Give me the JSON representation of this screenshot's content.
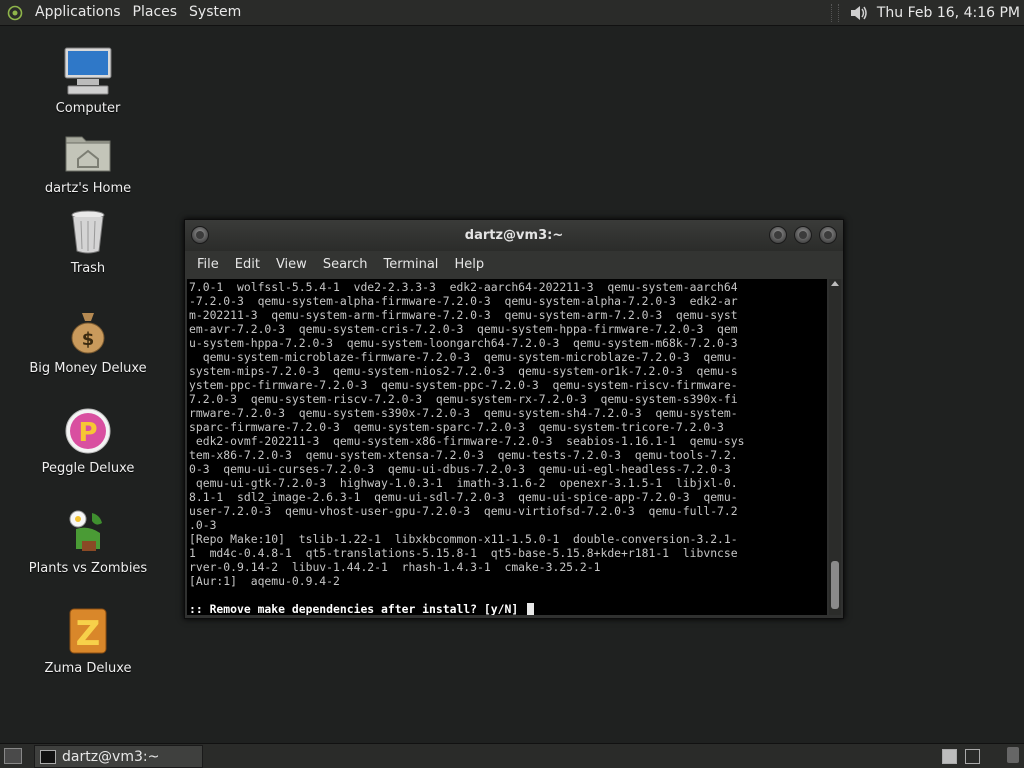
{
  "top_panel": {
    "menus": [
      "Applications",
      "Places",
      "System"
    ],
    "clock": "Thu Feb 16,  4:16 PM"
  },
  "desktop_icons": [
    {
      "label": "Computer",
      "icon": "computer-icon"
    },
    {
      "label": "dartz's Home",
      "icon": "home-folder-icon"
    },
    {
      "label": "Trash",
      "icon": "trash-icon"
    },
    {
      "label": "Big Money Deluxe",
      "icon": "money-bag-icon"
    },
    {
      "label": "Peggle Deluxe",
      "icon": "peggle-icon"
    },
    {
      "label": "Plants vs Zombies",
      "icon": "plants-vs-zombies-icon"
    },
    {
      "label": "Zuma Deluxe",
      "icon": "zuma-icon"
    }
  ],
  "terminal": {
    "title": "dartz@vm3:~",
    "menu": [
      "File",
      "Edit",
      "View",
      "Search",
      "Terminal",
      "Help"
    ],
    "lines": [
      "7.0-1  wolfssl-5.5.4-1  vde2-2.3.3-3  edk2-aarch64-202211-3  qemu-system-aarch64",
      "-7.2.0-3  qemu-system-alpha-firmware-7.2.0-3  qemu-system-alpha-7.2.0-3  edk2-ar",
      "m-202211-3  qemu-system-arm-firmware-7.2.0-3  qemu-system-arm-7.2.0-3  qemu-syst",
      "em-avr-7.2.0-3  qemu-system-cris-7.2.0-3  qemu-system-hppa-firmware-7.2.0-3  qem",
      "u-system-hppa-7.2.0-3  qemu-system-loongarch64-7.2.0-3  qemu-system-m68k-7.2.0-3",
      "  qemu-system-microblaze-firmware-7.2.0-3  qemu-system-microblaze-7.2.0-3  qemu-",
      "system-mips-7.2.0-3  qemu-system-nios2-7.2.0-3  qemu-system-or1k-7.2.0-3  qemu-s",
      "ystem-ppc-firmware-7.2.0-3  qemu-system-ppc-7.2.0-3  qemu-system-riscv-firmware-",
      "7.2.0-3  qemu-system-riscv-7.2.0-3  qemu-system-rx-7.2.0-3  qemu-system-s390x-fi",
      "rmware-7.2.0-3  qemu-system-s390x-7.2.0-3  qemu-system-sh4-7.2.0-3  qemu-system-",
      "sparc-firmware-7.2.0-3  qemu-system-sparc-7.2.0-3  qemu-system-tricore-7.2.0-3",
      " edk2-ovmf-202211-3  qemu-system-x86-firmware-7.2.0-3  seabios-1.16.1-1  qemu-sys",
      "tem-x86-7.2.0-3  qemu-system-xtensa-7.2.0-3  qemu-tests-7.2.0-3  qemu-tools-7.2.",
      "0-3  qemu-ui-curses-7.2.0-3  qemu-ui-dbus-7.2.0-3  qemu-ui-egl-headless-7.2.0-3",
      " qemu-ui-gtk-7.2.0-3  highway-1.0.3-1  imath-3.1.6-2  openexr-3.1.5-1  libjxl-0.",
      "8.1-1  sdl2_image-2.6.3-1  qemu-ui-sdl-7.2.0-3  qemu-ui-spice-app-7.2.0-3  qemu-",
      "user-7.2.0-3  qemu-vhost-user-gpu-7.2.0-3  qemu-virtiofsd-7.2.0-3  qemu-full-7.2",
      ".0-3",
      "[Repo Make:10]  tslib-1.22-1  libxkbcommon-x11-1.5.0-1  double-conversion-3.2.1-",
      "1  md4c-0.4.8-1  qt5-translations-5.15.8-1  qt5-base-5.15.8+kde+r181-1  libvncse",
      "rver-0.9.14-2  libuv-1.44.2-1  rhash-1.4.3-1  cmake-3.25.2-1",
      "[Aur:1]  aqemu-0.9.4-2",
      "",
      ":: Remove make dependencies after install? [y/N] "
    ]
  },
  "taskbar": {
    "task_label": "dartz@vm3:~"
  }
}
